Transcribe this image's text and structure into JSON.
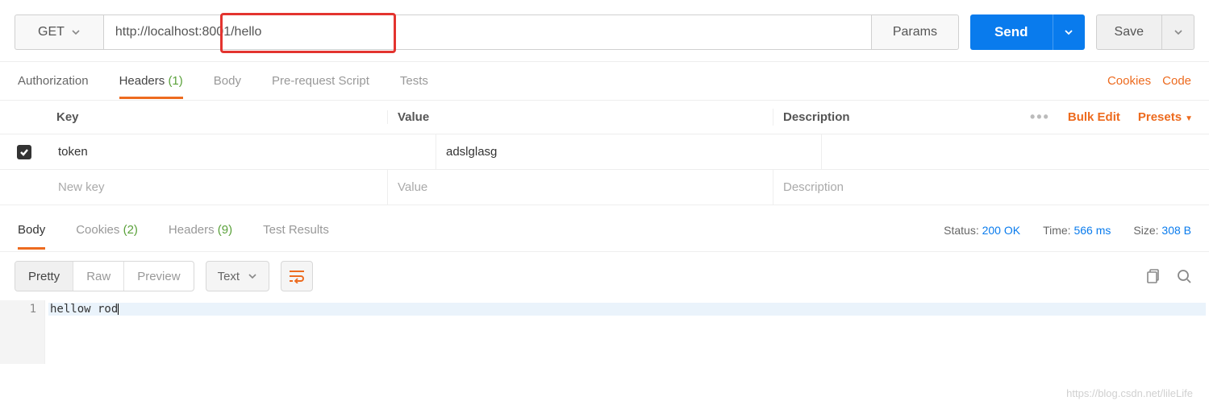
{
  "request": {
    "method": "GET",
    "url": "http://localhost:8001/hello",
    "params_label": "Params",
    "send_label": "Send",
    "save_label": "Save"
  },
  "req_tabs": {
    "authorization": "Authorization",
    "headers": "Headers",
    "headers_count": "(1)",
    "body": "Body",
    "prerequest": "Pre-request Script",
    "tests": "Tests"
  },
  "links": {
    "cookies": "Cookies",
    "code": "Code"
  },
  "headers_table": {
    "col_key": "Key",
    "col_value": "Value",
    "col_desc": "Description",
    "bulk_edit": "Bulk Edit",
    "presets": "Presets",
    "rows": [
      {
        "enabled": true,
        "key": "token",
        "value": "adslglasg",
        "desc": ""
      }
    ],
    "placeholder_key": "New key",
    "placeholder_value": "Value",
    "placeholder_desc": "Description"
  },
  "resp_tabs": {
    "body": "Body",
    "cookies": "Cookies",
    "cookies_count": "(2)",
    "headers": "Headers",
    "headers_count": "(9)",
    "tests": "Test Results"
  },
  "resp_meta": {
    "status_label": "Status:",
    "status_value": "200 OK",
    "time_label": "Time:",
    "time_value": "566 ms",
    "size_label": "Size:",
    "size_value": "308 B"
  },
  "body_toolbar": {
    "pretty": "Pretty",
    "raw": "Raw",
    "preview": "Preview",
    "text_mode": "Text"
  },
  "response_body": {
    "lines": [
      "hellow rod"
    ]
  },
  "watermark": "https://blog.csdn.net/lileLife"
}
